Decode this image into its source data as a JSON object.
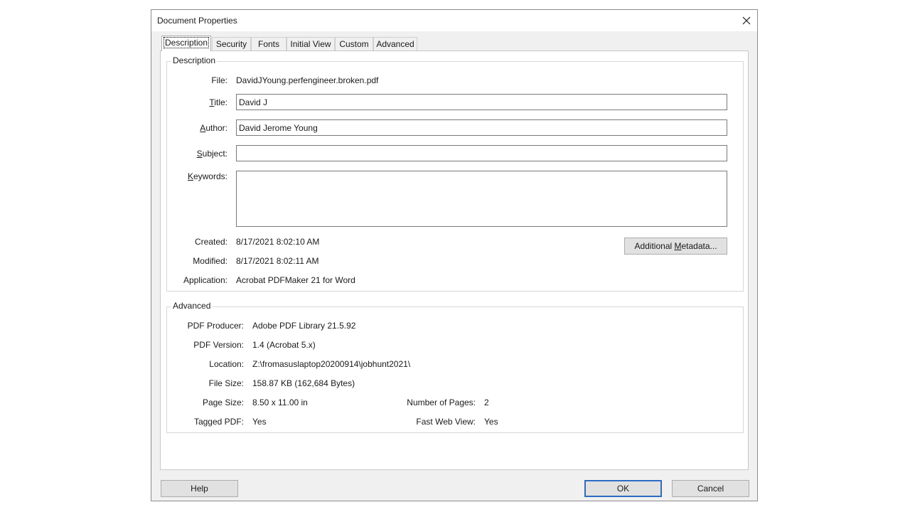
{
  "dialog": {
    "title": "Document Properties"
  },
  "tabs": [
    {
      "label": "Description"
    },
    {
      "label": "Security"
    },
    {
      "label": "Fonts"
    },
    {
      "label": "Initial View"
    },
    {
      "label": "Custom"
    },
    {
      "label": "Advanced"
    }
  ],
  "description": {
    "group_label": "Description",
    "file_label": "File:",
    "file_value": "DavidJYoung.perfengineer.broken.pdf",
    "title_label_accel": "T",
    "title_label_rest": "itle:",
    "title_value": "David J",
    "author_label_accel": "A",
    "author_label_rest": "uthor:",
    "author_value": "David Jerome Young",
    "subject_label_accel": "S",
    "subject_label_rest": "ubject:",
    "subject_value": "",
    "keywords_label_accel": "K",
    "keywords_label_rest": "eywords:",
    "keywords_value": "",
    "created_label": "Created:",
    "created_value": "8/17/2021 8:02:10 AM",
    "modified_label": "Modified:",
    "modified_value": "8/17/2021 8:02:11 AM",
    "application_label": "Application:",
    "application_value": "Acrobat PDFMaker 21 for Word",
    "metadata_button_pre": "Additional ",
    "metadata_button_accel": "M",
    "metadata_button_post": "etadata..."
  },
  "advanced": {
    "group_label": "Advanced",
    "producer_label": "PDF Producer:",
    "producer_value": "Adobe PDF Library 21.5.92",
    "version_label": "PDF Version:",
    "version_value": "1.4 (Acrobat 5.x)",
    "location_label": "Location:",
    "location_value": "Z:\\fromasuslaptop20200914\\jobhunt2021\\",
    "filesize_label": "File Size:",
    "filesize_value": "158.87 KB (162,684 Bytes)",
    "pagesize_label": "Page Size:",
    "pagesize_value": "8.50 x 11.00 in",
    "numpages_label": "Number of Pages:",
    "numpages_value": "2",
    "tagged_label": "Tagged PDF:",
    "tagged_value": "Yes",
    "fastweb_label": "Fast Web View:",
    "fastweb_value": "Yes"
  },
  "buttons": {
    "help": "Help",
    "ok": "OK",
    "cancel": "Cancel"
  },
  "icons": {
    "close": "close-icon"
  },
  "colors": {
    "default_button_border": "#2b6cc4",
    "dialog_background": "#f0f0f0"
  }
}
